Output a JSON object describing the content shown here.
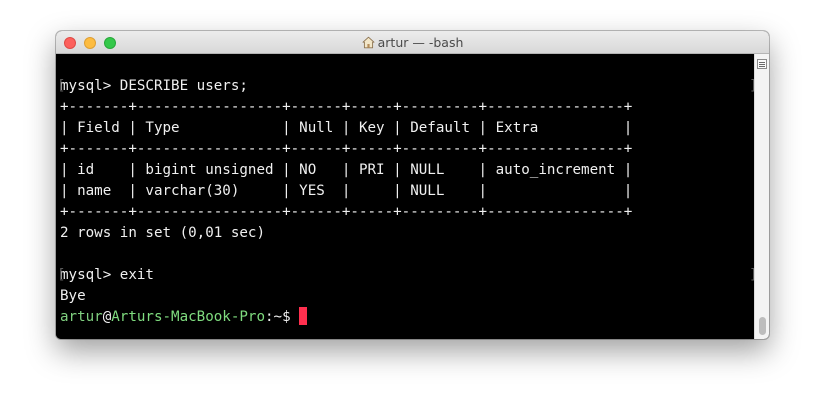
{
  "window": {
    "title": "artur — -bash",
    "home_icon": "home-icon"
  },
  "terminal": {
    "lines": [
      {
        "text": "mysql> DESCRIBE users;",
        "bracketed": true
      },
      {
        "text": "+-------+-----------------+------+-----+---------+----------------+"
      },
      {
        "text": "| Field | Type            | Null | Key | Default | Extra          |"
      },
      {
        "text": "+-------+-----------------+------+-----+---------+----------------+"
      },
      {
        "text": "| id    | bigint unsigned | NO   | PRI | NULL    | auto_increment |"
      },
      {
        "text": "| name  | varchar(30)     | YES  |     | NULL    |                |"
      },
      {
        "text": "+-------+-----------------+------+-----+---------+----------------+"
      },
      {
        "text": "2 rows in set (0,01 sec)"
      },
      {
        "text": ""
      },
      {
        "text": "mysql> exit",
        "bracketed": true
      },
      {
        "text": "Bye"
      }
    ],
    "prompt": {
      "user": "artur",
      "at": "@",
      "host": "Arturs-MacBook-Pro",
      "suffix": ":~$"
    },
    "cursor_color": "#ff2f4e",
    "prompt_color": "#7fcf7f"
  },
  "scrollbar": {
    "menu_icon": "list-icon"
  }
}
